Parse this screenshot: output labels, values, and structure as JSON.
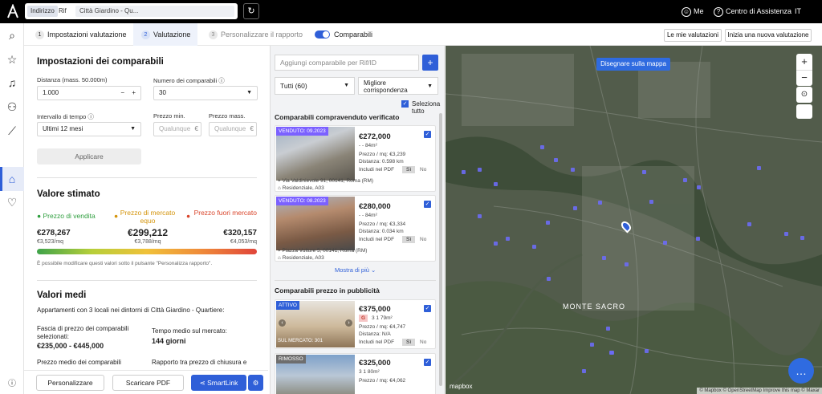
{
  "topbar": {
    "indirizzo": "Indirizzo",
    "rif": "Rif",
    "address": "Città Giardino - Qu...",
    "me": "Me",
    "help": "Centro di Assistenza",
    "lang": "IT"
  },
  "steps": [
    {
      "num": "1",
      "label": "Impostazioni valutazione"
    },
    {
      "num": "2",
      "label": "Valutazione"
    },
    {
      "num": "3",
      "label": "Personalizzare il rapporto"
    }
  ],
  "comparabili_toggle": "Comparabili",
  "actions": {
    "my_valuations": "Le mie valutazioni",
    "new_valuation": "Inizia una nuova valutazione"
  },
  "settings": {
    "title": "Impostazioni dei comparabili",
    "distance_label": "Distanza (mass. 50.000m)",
    "distance_value": "1.000",
    "rooms_label": "Numero dei comparabili",
    "rooms_value": "30",
    "time_label": "Intervallo di tempo",
    "time_value": "Ultimi 12 mesi",
    "min_label": "Prezzo min.",
    "min_placeholder": "Qualunque",
    "max_label": "Prezzo mass.",
    "max_placeholder": "Qualunque",
    "currency": "€",
    "apply": "Applicare"
  },
  "estimate": {
    "title": "Valore stimato",
    "sale_label": "Prezzo di vendita",
    "fair_label": "Prezzo di mercato equo",
    "over_label": "Prezzo fuori mercato",
    "sale_value": "€278,267",
    "sale_sqm": "€3,523/mq",
    "fair_value": "€299,212",
    "fair_sqm": "€3,788/mq",
    "over_value": "€320,157",
    "over_sqm": "€4,053/mq",
    "note": "È possibile modificare questi valori sotto il pulsante \"Personalizza rapporto\"."
  },
  "averages": {
    "title": "Valori medi",
    "subtitle": "Appartamenti con 3 locali nei dintorni di Città Giardino - Quartiere:",
    "range_label": "Fascia di prezzo dei comparabili selezionati:",
    "range_value": "€235,000 - €445,000",
    "time_label": "Tempo medio sul mercato:",
    "time_value": "144 giorni",
    "avg_label": "Prezzo medio dei comparabili",
    "ratio_label": "Rapporto tra prezzo di chiusura e"
  },
  "footer": {
    "personalize": "Personalizzare",
    "download": "Scaricare PDF",
    "smartlink": "SmartLink"
  },
  "comparables": {
    "add_placeholder": "Aggiungi comparabile per Rif/ID",
    "filter": "Tutti (60)",
    "sort": "Migliore corrispondenza",
    "select_all": "Seleziona tutto",
    "verified_title": "Comparabili compravenduto verificato",
    "advert_title": "Comparabili prezzo in pubblicità",
    "show_more": "Mostra di più",
    "verified": [
      {
        "tag": "VENDUTO: 09.2023",
        "price": "€272,000",
        "specs": "-  -  84m²",
        "sqm": "Prezzo / mq: €3,239",
        "dist": "Distanza: 0.598 km",
        "pdf": "Includi nel PDF",
        "yes": "Sì",
        "no": "No",
        "address": "Via Valdinievole 91, 00141, Roma (RM)",
        "type": "Residenziale, A03"
      },
      {
        "tag": "VENDUTO: 08.2023",
        "price": "€280,000",
        "specs": "-  -  84m²",
        "sqm": "Prezzo / mq: €3,334",
        "dist": "Distanza: 0.034 km",
        "pdf": "Includi nel PDF",
        "yes": "Sì",
        "no": "No",
        "address": "Piazza Vulture 5, 00141, Roma (RM)",
        "type": "Residenziale, A03"
      }
    ],
    "advert": [
      {
        "tag": "ATTIVO",
        "badge": "G",
        "price": "€375,000",
        "specs": "3  1  79m²",
        "sqm": "Prezzo / mq: €4,747",
        "dist": "Distanza: N/A",
        "pdf": "Includi nel PDF",
        "yes": "Sì",
        "no": "No",
        "market": "SUL MERCATO: 301"
      },
      {
        "tag": "RIMOSSO",
        "price": "€325,000",
        "specs": "3  1  80m²",
        "sqm": "Prezzo / mq: €4,062"
      }
    ]
  },
  "map": {
    "draw_button": "Disegnare sulla mappa",
    "area_label": "MONTE SACRO",
    "credits": "© Mapbox © OpenStreetMap Improve this map © Maxar",
    "mapbox_logo": "mapbox"
  },
  "colors": {
    "accent": "#2f5fd8",
    "sold": "#7b61ff",
    "active": "#2f5fd8",
    "green": "#2e9e3e",
    "amber": "#e8a317",
    "red": "#d9452b"
  }
}
